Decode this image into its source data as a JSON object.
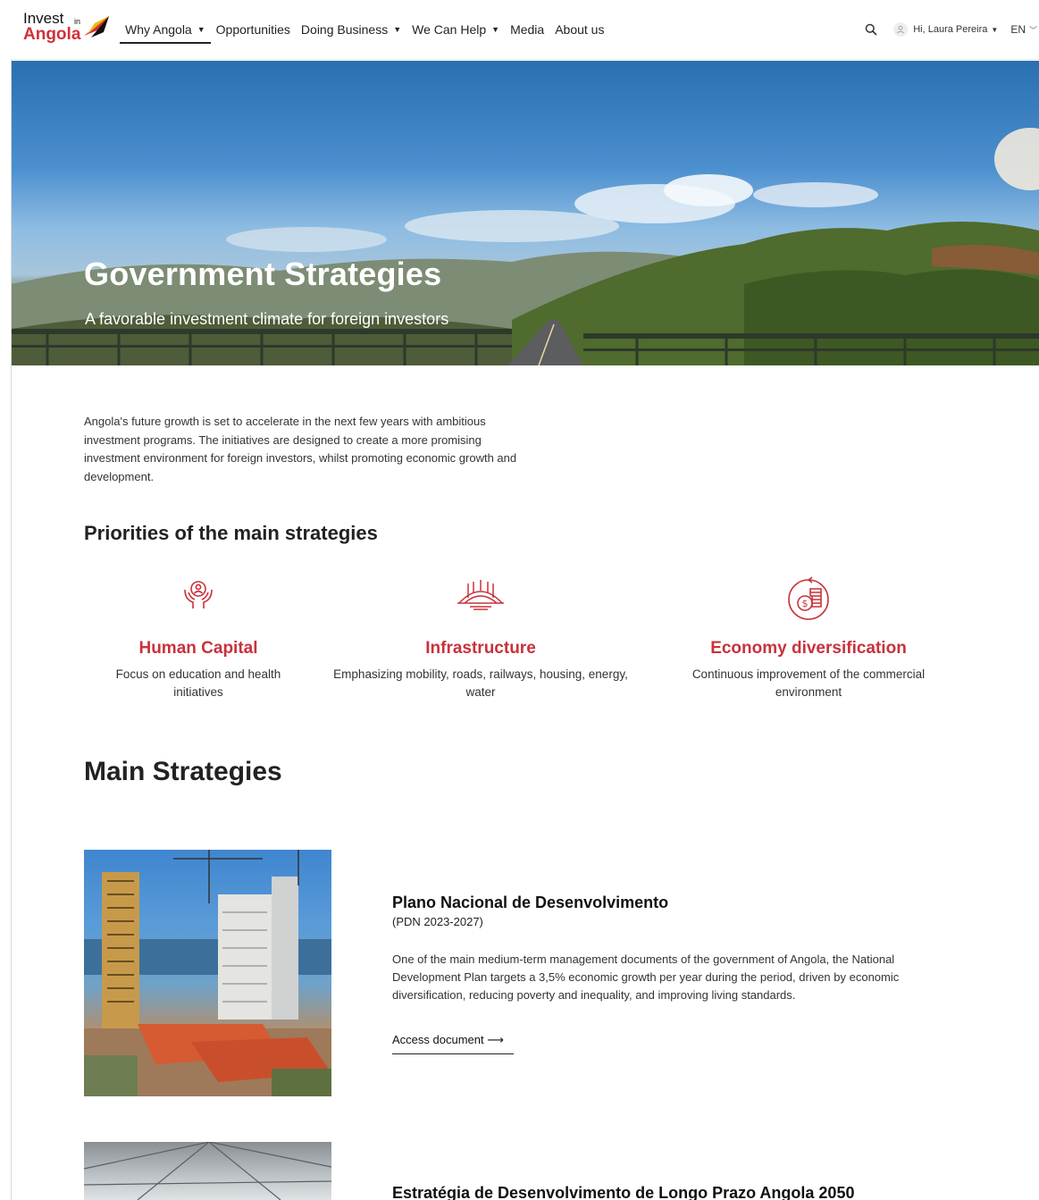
{
  "logo": {
    "line1": "Invest",
    "in": "in",
    "line2": "Angola"
  },
  "nav": [
    {
      "label": "Why Angola",
      "dropdown": true
    },
    {
      "label": "Opportunities",
      "dropdown": false
    },
    {
      "label": "Doing Business",
      "dropdown": true
    },
    {
      "label": "We Can Help",
      "dropdown": true
    },
    {
      "label": "Media",
      "dropdown": false
    },
    {
      "label": "About us",
      "dropdown": false
    }
  ],
  "header_right": {
    "search_icon": "search-icon",
    "user_label": "Hi, Laura Pereira",
    "language": "EN"
  },
  "hero": {
    "title": "Government Strategies",
    "subtitle": "A favorable investment climate for foreign investors"
  },
  "intro": "Angola's future growth is set to accelerate in the next few years with ambitious investment programs. The initiatives are designed to create a more promising investment environment for foreign investors, whilst promoting economic growth and development.",
  "priorities": {
    "title": "Priorities of the main strategies",
    "items": [
      {
        "icon": "human-capital-icon",
        "title": "Human Capital",
        "text": "Focus on education and health initiatives"
      },
      {
        "icon": "infrastructure-bridge-icon",
        "title": "Infrastructure",
        "text": "Emphasizing mobility, roads, railways, housing, energy, water"
      },
      {
        "icon": "economy-coins-icon",
        "title": "Economy diversification",
        "text": "Continuous improvement of the commercial environment"
      }
    ]
  },
  "main_strategies": {
    "title": "Main Strategies",
    "items": [
      {
        "title": "Plano Nacional de Desenvolvimento",
        "subtitle": "(PDN 2023-2027)",
        "description": "One of the main medium-term management documents of the government of Angola, the National Development Plan targets a 3,5% economic growth per year during the period, driven by economic diversification, reducing poverty and inequality, and improving living standards.",
        "link": "Access document"
      },
      {
        "title": "Estratégia de Desenvolvimento de Longo Prazo Angola 2050"
      }
    ]
  },
  "colors": {
    "accent": "#c8323c",
    "text": "#222222"
  }
}
